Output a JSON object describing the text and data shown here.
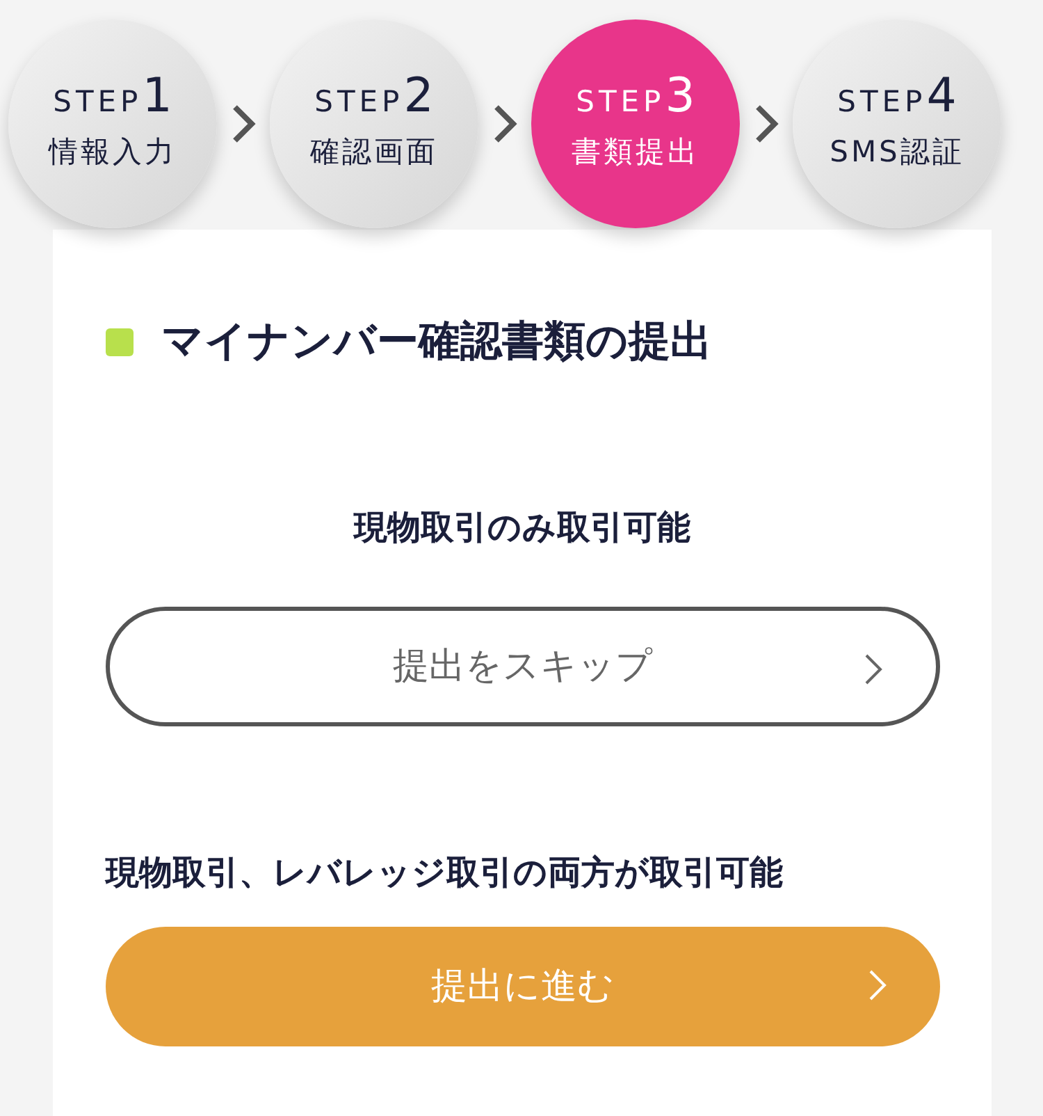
{
  "steps": [
    {
      "label": "STEP",
      "number": "1",
      "name": "情報入力",
      "selected": false
    },
    {
      "label": "STEP",
      "number": "2",
      "name": "確認画面",
      "selected": false
    },
    {
      "label": "STEP",
      "number": "3",
      "name": "書類提出",
      "selected": true
    },
    {
      "label": "STEP",
      "number": "4",
      "name": "SMS認証",
      "selected": false
    }
  ],
  "card": {
    "heading": "マイナンバー確認書類の提出",
    "options": [
      {
        "kind": "outline",
        "note": "現物取引のみ取引可能",
        "button": "提出をスキップ"
      },
      {
        "kind": "filled",
        "note": "現物取引、レバレッジ取引の両方が取引可能",
        "button": "提出に進む"
      }
    ]
  }
}
